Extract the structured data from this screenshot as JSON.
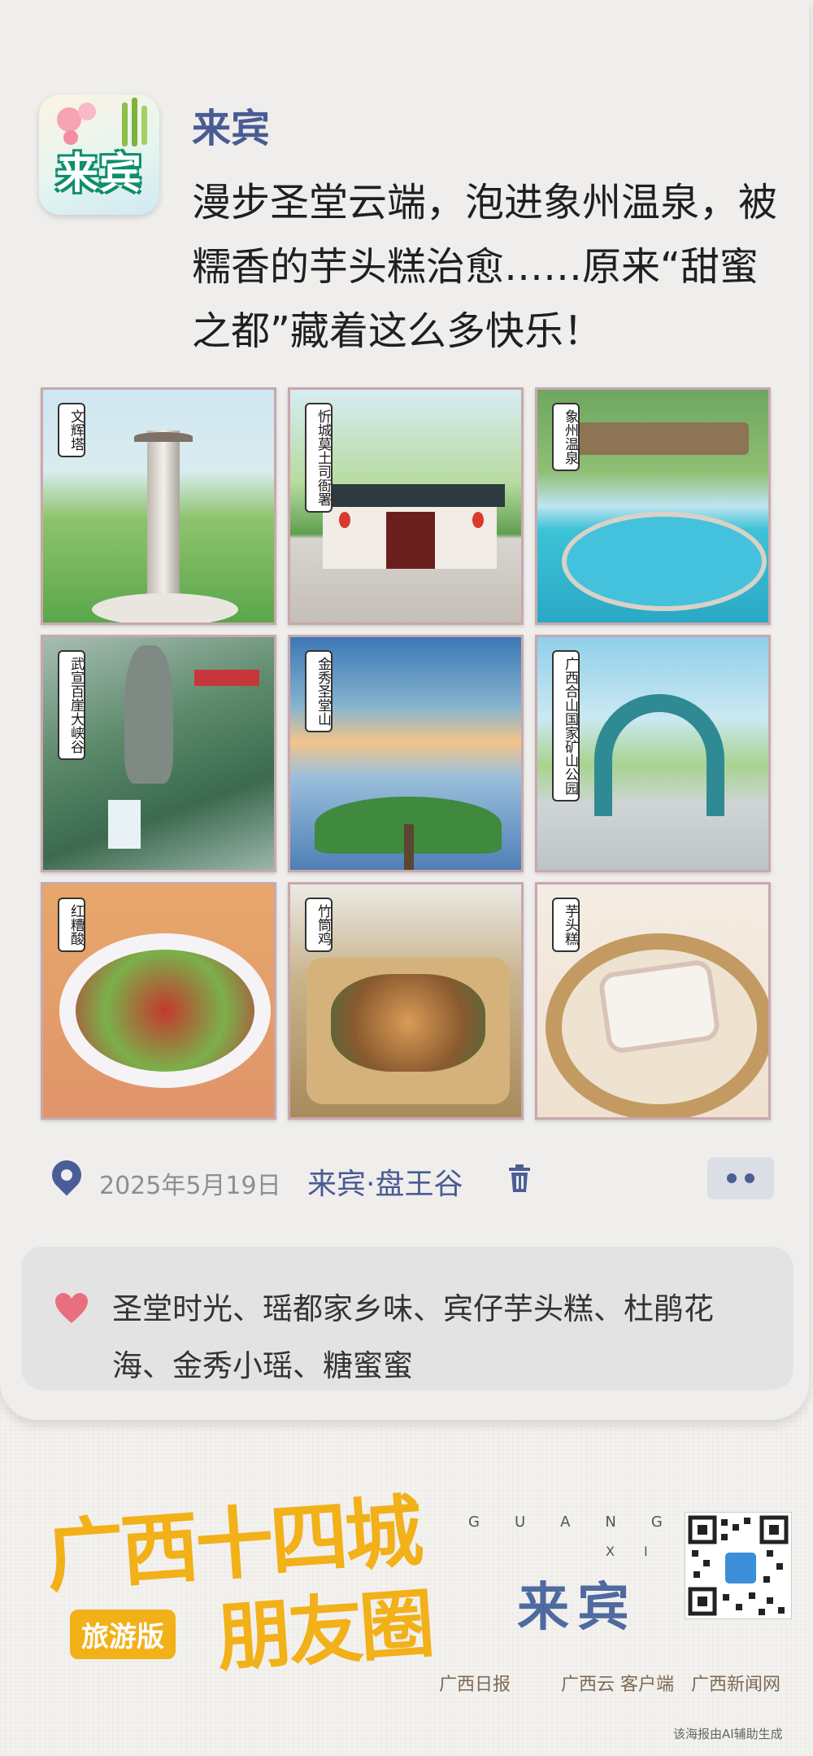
{
  "colors": {
    "accent_blue": "#4a5b93",
    "brand_yellow": "#f2b019",
    "heart_pink": "#e8707e",
    "card_bg": "#efeeec"
  },
  "post": {
    "avatar_text": "来宾",
    "name": "来宾",
    "headline": "漫步圣堂云端，泡进象州温泉，被糯香的芋头糕治愈……原来“甜蜜之都”藏着这么多快乐！"
  },
  "photos": [
    {
      "label": "文辉塔"
    },
    {
      "label": "忻城莫土司衙署"
    },
    {
      "label": "象州温泉"
    },
    {
      "label": "武宣百崖大峡谷"
    },
    {
      "label": "金秀圣堂山"
    },
    {
      "label": "广西合山国家矿山公园"
    },
    {
      "label": "红糟酸"
    },
    {
      "label": "竹筒鸡"
    },
    {
      "label": "芋头糕"
    }
  ],
  "meta": {
    "location_icon": "map-pin-icon",
    "date": "2025年5月19日",
    "location": "来宾·盘王谷",
    "delete_icon": "trash-icon",
    "more_icon": "more-dots-icon"
  },
  "likes": {
    "icon": "heart-icon",
    "text": "圣堂时光、瑶都家乡味、宾仔芋头糕、杜鹃花海、金秀小瑶、糖蜜蜜"
  },
  "footer": {
    "title_line1": "广西十四城",
    "title_line2": "朋友圈",
    "badge": "旅游版",
    "guang": "GUANG",
    "xi": "XI",
    "city": "来宾",
    "logos": [
      "广西日报",
      "广西云 客户端",
      "广西新闻网"
    ],
    "disclaimer": "该海报由AI辅助生成"
  }
}
